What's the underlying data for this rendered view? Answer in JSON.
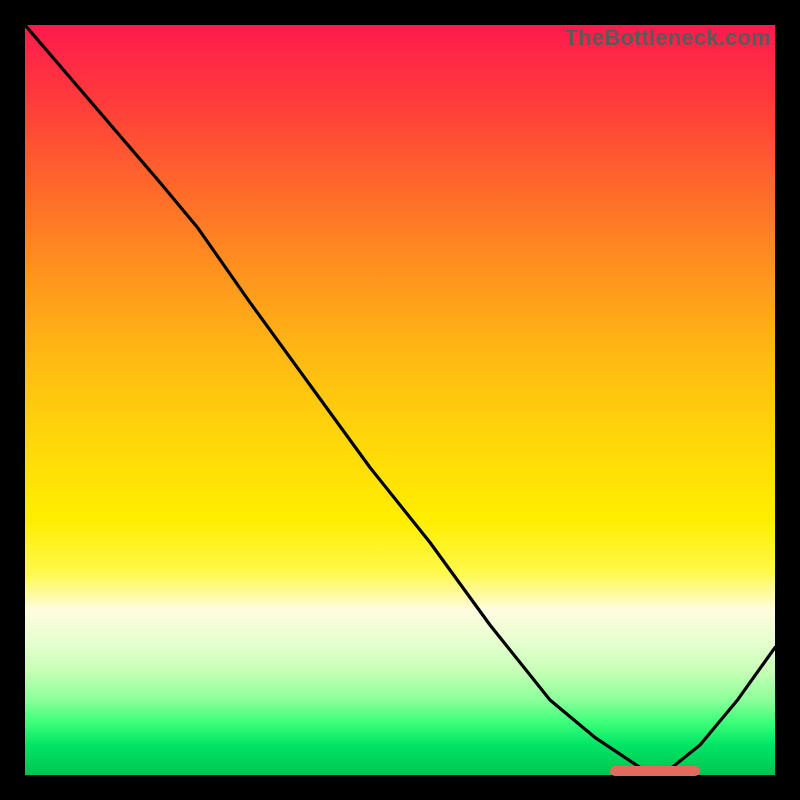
{
  "watermark": "TheBottleneck.com",
  "colors": {
    "marker": "#e46a5e",
    "curve": "#000000"
  },
  "chart_data": {
    "type": "line",
    "title": "",
    "xlabel": "",
    "ylabel": "",
    "xlim": [
      0,
      100
    ],
    "ylim": [
      0,
      100
    ],
    "grid": false,
    "legend": false,
    "series": [
      {
        "name": "curve",
        "x": [
          0,
          6,
          12,
          18,
          23,
          30,
          38,
          46,
          54,
          62,
          70,
          76,
          82,
          85,
          90,
          95,
          100
        ],
        "y": [
          100,
          93,
          86,
          79,
          73,
          63,
          52,
          41,
          31,
          20,
          10,
          5,
          1,
          0,
          4,
          10,
          17
        ]
      }
    ],
    "marker": {
      "x_start": 78,
      "x_end": 90,
      "y": 0.5
    }
  }
}
